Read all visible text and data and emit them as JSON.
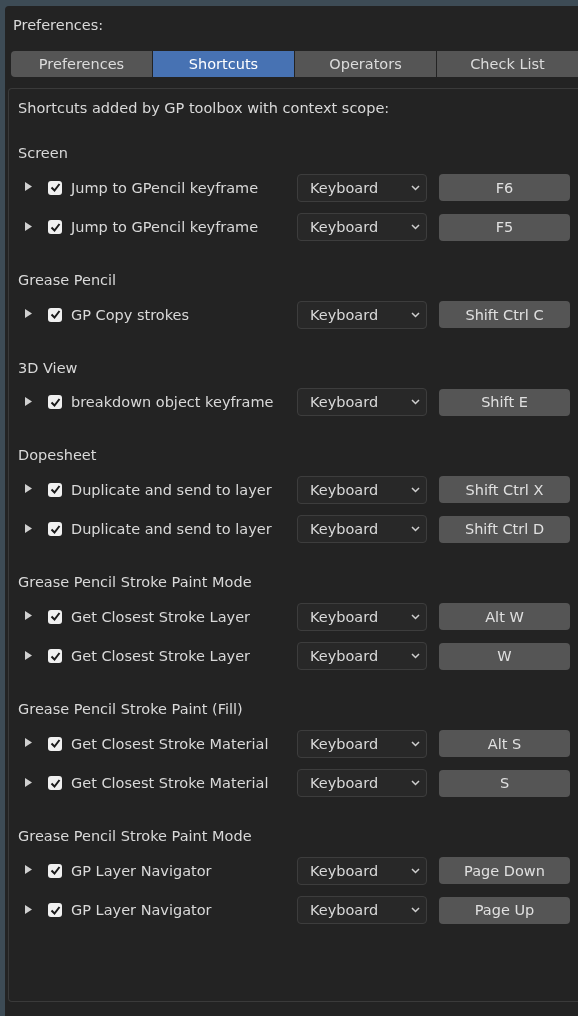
{
  "title": "Preferences:",
  "tabs": [
    {
      "label": "Preferences",
      "selected": false
    },
    {
      "label": "Shortcuts",
      "selected": true
    },
    {
      "label": "Operators",
      "selected": false
    },
    {
      "label": "Check List",
      "selected": false
    }
  ],
  "panel": {
    "heading": "Shortcuts added by GP toolbox with context scope:",
    "groups": [
      {
        "name": "Screen",
        "shortcuts": [
          {
            "expanded": false,
            "enabled": true,
            "label": "Jump to GPencil keyframe",
            "input_type": "Keyboard",
            "key": "F6"
          },
          {
            "expanded": false,
            "enabled": true,
            "label": "Jump to GPencil keyframe",
            "input_type": "Keyboard",
            "key": "F5"
          }
        ]
      },
      {
        "name": "Grease Pencil",
        "shortcuts": [
          {
            "expanded": false,
            "enabled": true,
            "label": "GP Copy strokes",
            "input_type": "Keyboard",
            "key": "Shift Ctrl C"
          }
        ]
      },
      {
        "name": "3D View",
        "shortcuts": [
          {
            "expanded": false,
            "enabled": true,
            "label": "breakdown object keyframe",
            "input_type": "Keyboard",
            "key": "Shift E"
          }
        ]
      },
      {
        "name": "Dopesheet",
        "shortcuts": [
          {
            "expanded": false,
            "enabled": true,
            "label": "Duplicate and send to layer",
            "input_type": "Keyboard",
            "key": "Shift Ctrl X"
          },
          {
            "expanded": false,
            "enabled": true,
            "label": "Duplicate and send to layer",
            "input_type": "Keyboard",
            "key": "Shift Ctrl D"
          }
        ]
      },
      {
        "name": "Grease Pencil Stroke Paint Mode",
        "shortcuts": [
          {
            "expanded": false,
            "enabled": true,
            "label": "Get Closest Stroke Layer",
            "input_type": "Keyboard",
            "key": "Alt W"
          },
          {
            "expanded": false,
            "enabled": true,
            "label": "Get Closest Stroke Layer",
            "input_type": "Keyboard",
            "key": "W"
          }
        ]
      },
      {
        "name": "Grease Pencil Stroke Paint (Fill)",
        "shortcuts": [
          {
            "expanded": false,
            "enabled": true,
            "label": "Get Closest Stroke Material",
            "input_type": "Keyboard",
            "key": "Alt S"
          },
          {
            "expanded": false,
            "enabled": true,
            "label": "Get Closest Stroke Material",
            "input_type": "Keyboard",
            "key": "S"
          }
        ]
      },
      {
        "name": "Grease Pencil Stroke Paint Mode",
        "shortcuts": [
          {
            "expanded": false,
            "enabled": true,
            "label": "GP Layer Navigator",
            "input_type": "Keyboard",
            "key": "Page Down"
          },
          {
            "expanded": false,
            "enabled": true,
            "label": "GP Layer Navigator",
            "input_type": "Keyboard",
            "key": "Page Up"
          }
        ]
      }
    ]
  }
}
